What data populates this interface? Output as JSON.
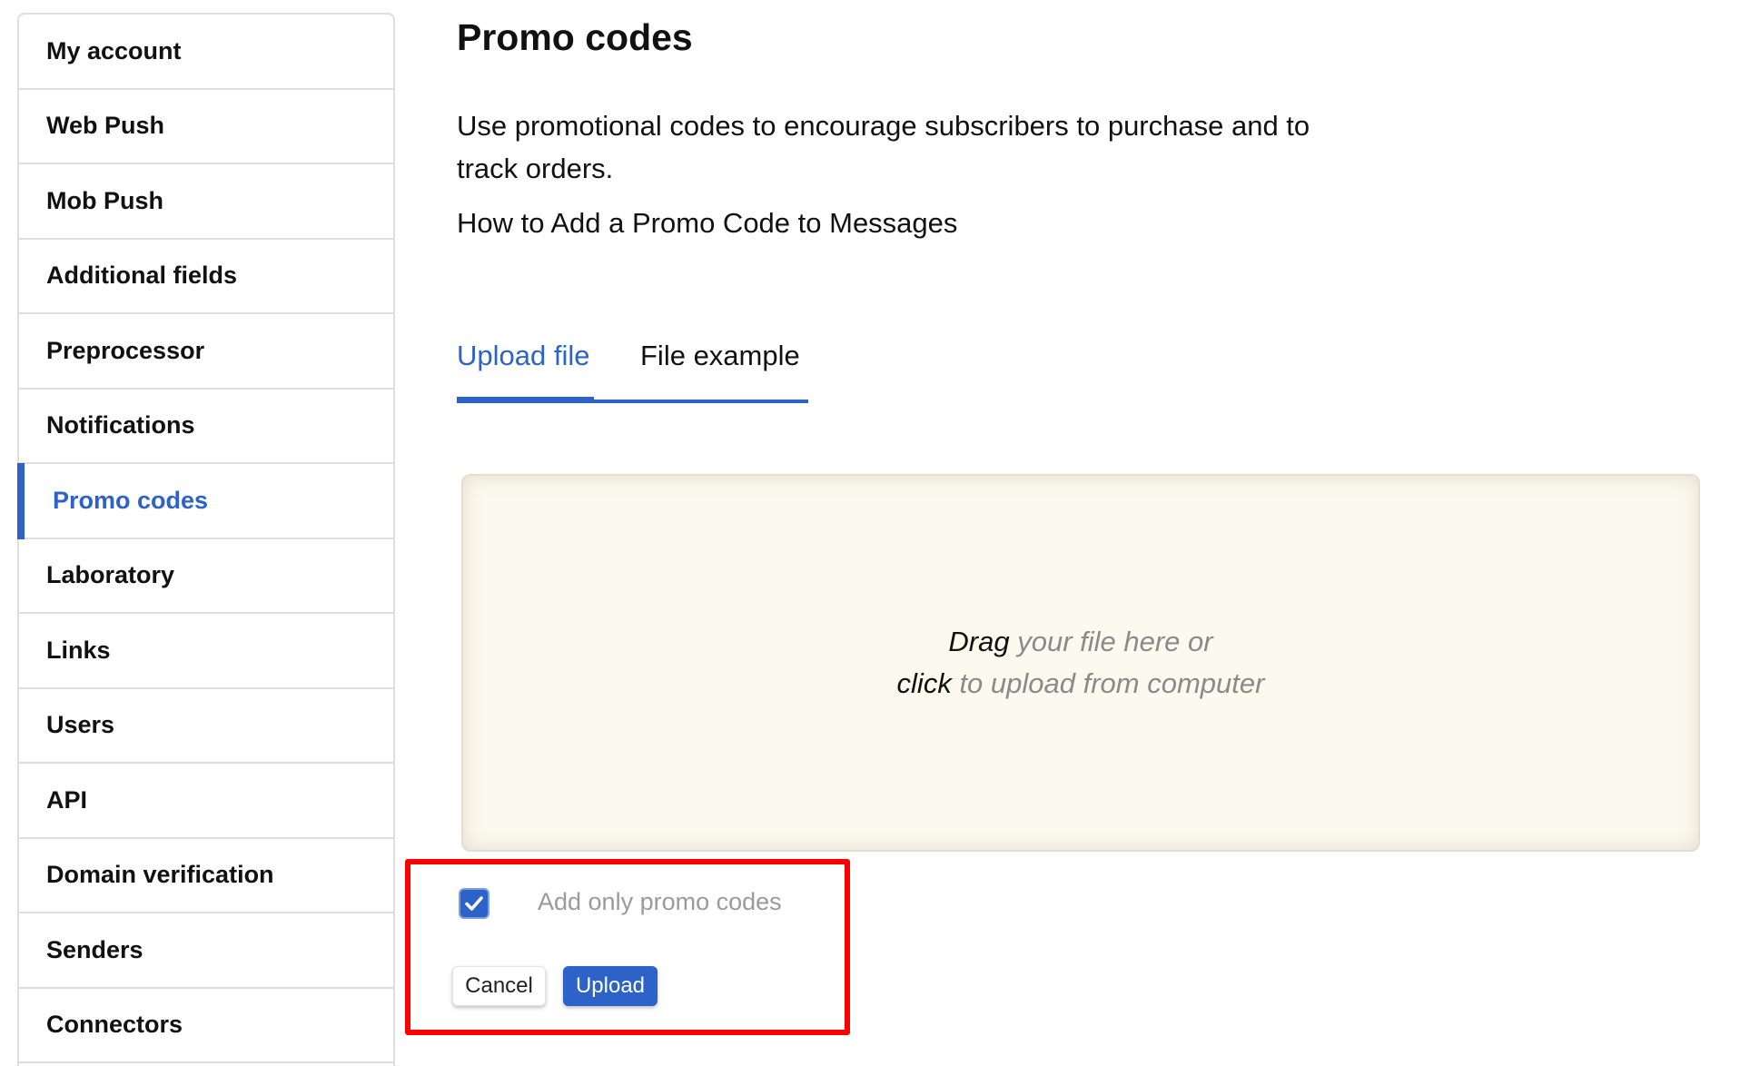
{
  "sidebar": {
    "active_index": 6,
    "items": [
      {
        "label": "My account"
      },
      {
        "label": "Web Push"
      },
      {
        "label": "Mob Push"
      },
      {
        "label": "Additional fields"
      },
      {
        "label": "Preprocessor"
      },
      {
        "label": "Notifications"
      },
      {
        "label": "Promo codes"
      },
      {
        "label": "Laboratory"
      },
      {
        "label": "Links"
      },
      {
        "label": "Users"
      },
      {
        "label": "API"
      },
      {
        "label": "Domain verification"
      },
      {
        "label": "Senders"
      },
      {
        "label": "Connectors"
      }
    ]
  },
  "page": {
    "title": "Promo codes",
    "description": "Use promotional codes to encourage subscribers to purchase and to track orders.",
    "howto_link": "How to Add a Promo Code to Messages"
  },
  "tabs": {
    "active": "Upload file",
    "items": [
      {
        "label": "Upload file"
      },
      {
        "label": "File example"
      }
    ]
  },
  "dropzone": {
    "line1_strong": "Drag",
    "line1_muted": " your file here or",
    "line2_strong": "click",
    "line2_muted": " to upload from computer"
  },
  "options": {
    "add_only_promo_codes_label": "Add only promo codes",
    "add_only_promo_codes_checked": true,
    "checkbox_icon": "check-icon"
  },
  "actions": {
    "cancel_label": "Cancel",
    "upload_label": "Upload"
  },
  "colors": {
    "accent": "#2d63c8",
    "dropzone_bg": "#fcf9ee",
    "highlight_box": "#ff0000"
  }
}
